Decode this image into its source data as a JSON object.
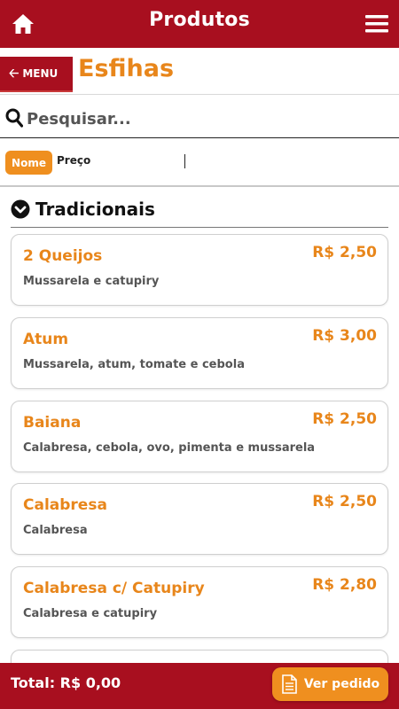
{
  "header": {
    "title": "Produtos",
    "home_icon": "home-icon",
    "menu_icon": "hamburger-menu-icon",
    "bar_color": "#a80f1f"
  },
  "section": {
    "back_label": "MENU",
    "title": "Esfihas",
    "accent_color": "#e8861b"
  },
  "search": {
    "placeholder": "Pesquisar...",
    "value": ""
  },
  "sort": {
    "options": [
      "Nome",
      "Preço"
    ],
    "active": "Nome"
  },
  "category": {
    "title": "Tradicionais"
  },
  "products": [
    {
      "name": "2 Queijos",
      "price": "R$ 2,50",
      "description": "Mussarela e catupiry"
    },
    {
      "name": "Atum",
      "price": "R$ 3,00",
      "description": "Mussarela, atum, tomate e cebola"
    },
    {
      "name": "Baiana",
      "price": "R$ 2,50",
      "description": "Calabresa, cebola, ovo, pimenta e mussarela"
    },
    {
      "name": "Calabresa",
      "price": "R$ 2,50",
      "description": "Calabresa"
    },
    {
      "name": "Calabresa c/ Catupiry",
      "price": "R$ 2,80",
      "description": "Calabresa e catupiry"
    }
  ],
  "footer": {
    "total_label": "Total: R$ 0,00",
    "order_button": "Ver pedido"
  }
}
